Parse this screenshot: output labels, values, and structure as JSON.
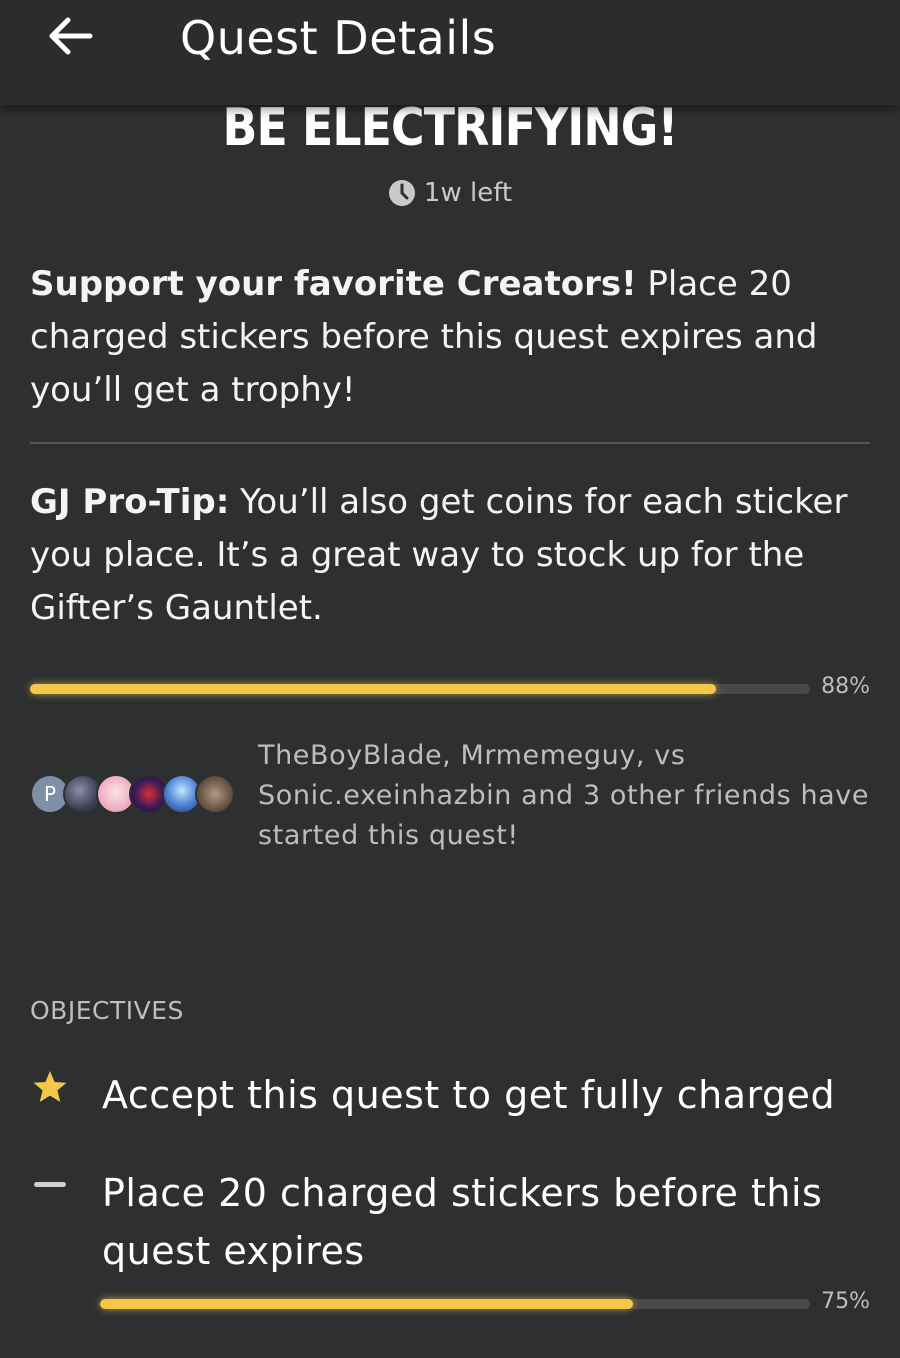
{
  "header": {
    "title": "Quest Details",
    "back_icon": "arrow-left-icon"
  },
  "quest": {
    "title": "BE ELECTRIFYING!",
    "time_left": "1w left",
    "description_bold": "Support your favorite Creators!",
    "description_rest": " Place 20 charged stickers before this quest expires and you’ll get a trophy!",
    "tip_bold": "GJ Pro-Tip:",
    "tip_rest": " You’ll also get coins for each sticker you place. It’s a great way to stock up for the Gifter’s Gauntlet.",
    "progress": 0.88,
    "progress_label": "88%"
  },
  "friends": {
    "first_avatar_initial": "P",
    "text": "TheBoyBlade, Mrmemeguy, vs Sonic.exeinhazbin and 3 other friends have started this quest!"
  },
  "objectives": {
    "label": "OBJECTIVES",
    "items": [
      {
        "text": "Accept this quest to get fully charged",
        "icon": "star-icon"
      },
      {
        "text": "Place 20 charged stickers before this quest expires",
        "icon": "dash-icon",
        "progress": 0.75,
        "progress_label": "75%"
      }
    ]
  },
  "colors": {
    "background": "#2e2f31",
    "accent": "#f3c84a"
  }
}
